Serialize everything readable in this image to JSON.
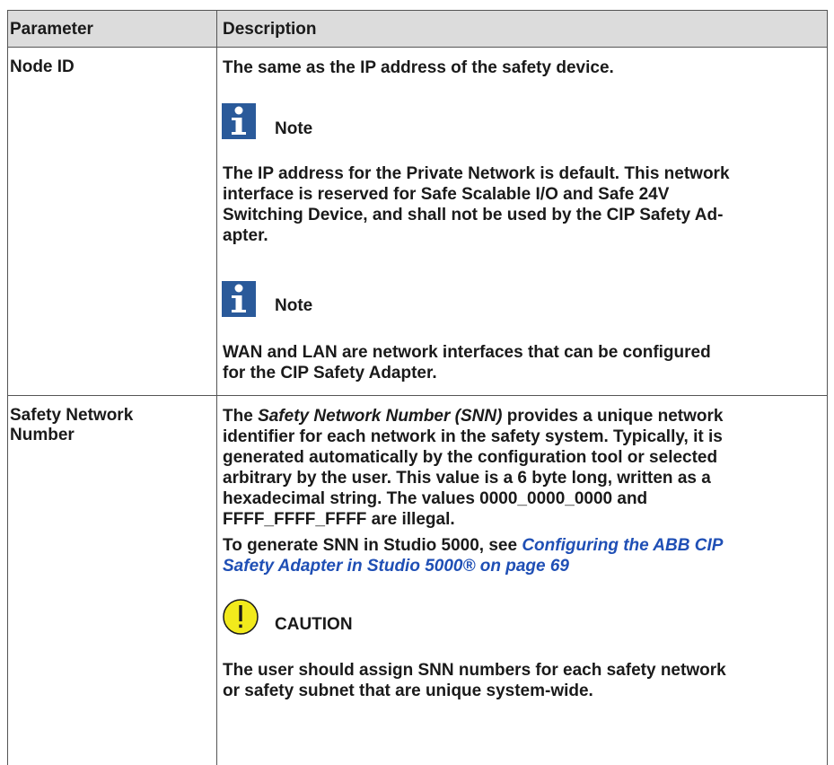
{
  "table": {
    "headers": {
      "parameter": "Parameter",
      "description": "Description"
    },
    "rows": [
      {
        "parameter": "Node ID",
        "intro": "The same as the IP address of the safety device.",
        "note1": {
          "label": "Note",
          "lines": [
            "The IP address for the Private Network is default. This network",
            "interface is reserved for Safe Scalable I/O and Safe 24V",
            "Switching Device, and shall not be used by the CIP Safety Ad-",
            "apter."
          ]
        },
        "note2": {
          "label": "Note",
          "lines": [
            "WAN and LAN are network interfaces that can be configured",
            "for the CIP Safety Adapter."
          ]
        }
      },
      {
        "parameter_lines": [
          "Safety Network",
          "Number"
        ],
        "para1": {
          "l1_pre": "The ",
          "l1_em": "Safety Network Number (SNN)",
          "l1_post": " provides a unique network",
          "lines": [
            "identifier for each network in the safety system. Typically, it is",
            "generated automatically by the configuration tool or selected",
            "arbitrary by the user. This value is a 6 byte long, written as a",
            "hexadecimal string. The values 0000_0000_0000 and",
            "FFFF_FFFF_FFFF are illegal."
          ]
        },
        "para2": {
          "pre": "To generate ",
          "strong": "SNN",
          "post": " in Studio 5000, see ",
          "link_line1": "Configuring the ABB CIP",
          "link_line2": "Safety Adapter in Studio 5000® on page 69"
        },
        "caution": {
          "label": "CAUTION",
          "l1_pre": "The user should assign ",
          "l1_strong": "SNN",
          "l1_post": " numbers for each safety network",
          "l2": "or safety subnet that are unique system-wide."
        }
      }
    ]
  },
  "colors": {
    "header_bg": "#dcdcdc",
    "note_icon": "#2a5a9a",
    "caution_icon": "#f2ea1c",
    "link": "#1f4fb5"
  }
}
